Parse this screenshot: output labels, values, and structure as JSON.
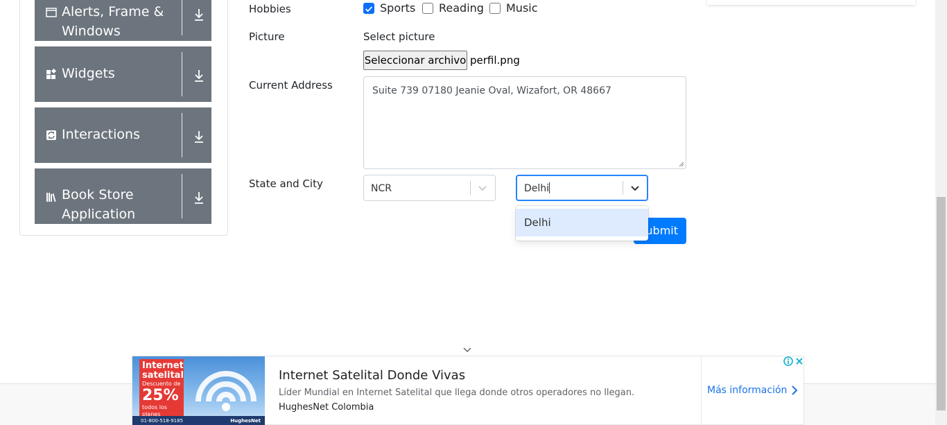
{
  "sidebar": {
    "groups": [
      {
        "label": "Alerts, Frame & Windows",
        "icon": "window-icon"
      },
      {
        "label": "Widgets",
        "icon": "widgets-icon"
      },
      {
        "label": "Interactions",
        "icon": "interactions-icon"
      },
      {
        "label": "Book Store Application",
        "icon": "books-icon"
      }
    ]
  },
  "form": {
    "hobbies_label": "Hobbies",
    "hobbies": [
      {
        "label": "Sports",
        "checked": true
      },
      {
        "label": "Reading",
        "checked": false
      },
      {
        "label": "Music",
        "checked": false
      }
    ],
    "picture_label": "Picture",
    "picture_hint": "Select picture",
    "file_button": "Seleccionar archivo",
    "file_name": "perfil.png",
    "address_label": "Current Address",
    "address_value": "Suite 739 07180 Jeanie Oval, Wizafort, OR 48667",
    "state_city_label": "State and City",
    "state_value": "NCR",
    "city_input": "Delhi",
    "city_options": [
      "Delhi"
    ],
    "submit_label": "Submit"
  },
  "ad": {
    "badge_line1": "Internet",
    "badge_line2": "satelital",
    "badge_line3": "Descuento de",
    "badge_percent": "25%",
    "badge_line4": "todos los planes",
    "phone": "01-800-518-9185",
    "brand_small": "HughesNet",
    "title": "Internet Satelital Donde Vivas",
    "description": "Líder Mundial en Internet Satelital que llega donde otros operadores no llegan.",
    "advertiser": "HughesNet Colombia",
    "cta": "Más información"
  },
  "colors": {
    "sidebar_bg": "#6c757d",
    "primary": "#007bff",
    "focus": "#2684ff",
    "option_highlight": "#deebff"
  }
}
